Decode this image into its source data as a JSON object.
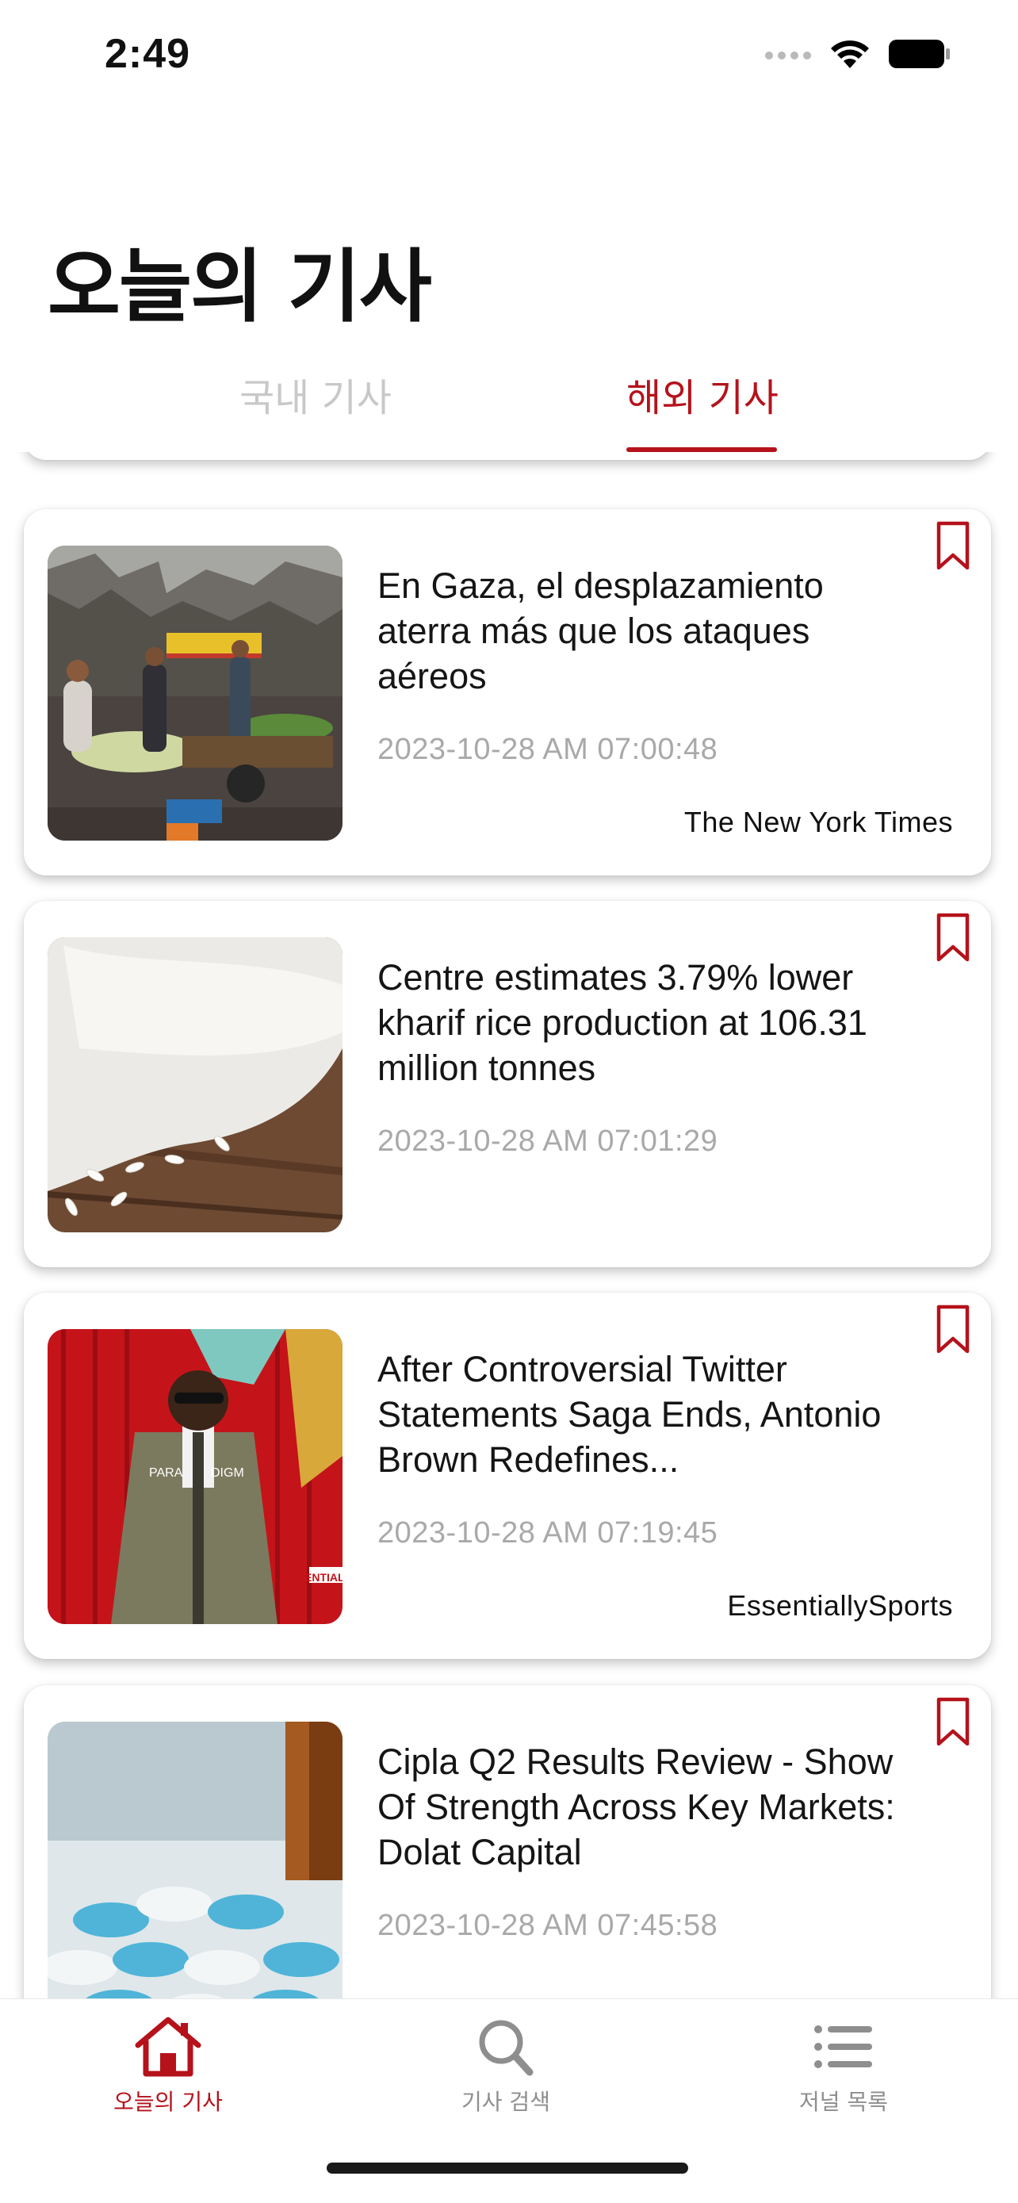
{
  "status_bar": {
    "time": "2:49"
  },
  "page_title": "오늘의 기사",
  "tabs": [
    {
      "label": "국내 기사",
      "active": false
    },
    {
      "label": "해외 기사",
      "active": true
    }
  ],
  "articles": [
    {
      "title": "En Gaza, el desplazamiento aterra más que los ataques aéreos",
      "date": "2023-10-28 AM 07:00:48",
      "source": "The New York Times",
      "thumbnail": "market-rubble-photo"
    },
    {
      "title": "Centre estimates 3.79% lower kharif rice production at 106.31 million tonnes",
      "date": "2023-10-28 AM 07:01:29",
      "source": "",
      "thumbnail": "rice-grains-photo"
    },
    {
      "title": "After Controversial Twitter Statements Saga Ends, Antonio Brown Redefines...",
      "date": "2023-10-28 AM 07:19:45",
      "source": "EssentiallySports",
      "thumbnail": "person-red-curtain-photo",
      "thumbnail_text": [
        "PARA",
        "DIGM",
        "ESSENTIALLY"
      ]
    },
    {
      "title": "Cipla Q2 Results Review - Show Of Strength Across Key Markets: Dolat Capital",
      "date": "2023-10-28 AM 07:45:58",
      "source": "",
      "thumbnail": "blue-pills-photo"
    }
  ],
  "bottom_nav": [
    {
      "label": "오늘의 기사",
      "icon": "home-icon",
      "active": true
    },
    {
      "label": "기사 검색",
      "icon": "search-icon",
      "active": false
    },
    {
      "label": "저널 목록",
      "icon": "list-icon",
      "active": false
    }
  ],
  "colors": {
    "accent": "#b5121b",
    "muted": "#a9a9a9",
    "inactive_tab": "#c8c8c8",
    "nav_inactive": "#8e8e8e"
  }
}
